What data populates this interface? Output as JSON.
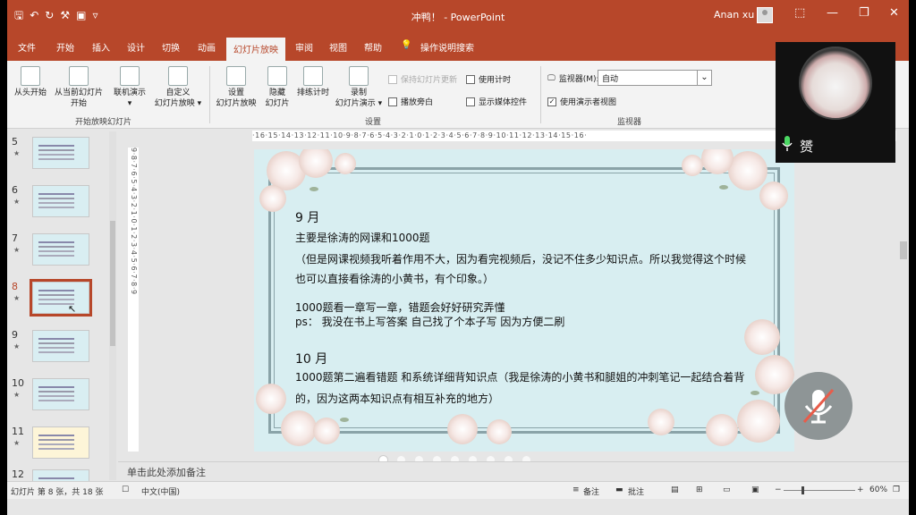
{
  "window": {
    "title": "冲鸭！  -  PowerPoint",
    "user": "Anan xu"
  },
  "tabs": [
    "文件",
    "开始",
    "插入",
    "设计",
    "切换",
    "动画",
    "幻灯片放映",
    "审阅",
    "视图",
    "帮助",
    "操作说明搜索"
  ],
  "active_tab": "幻灯片放映",
  "ribbon": {
    "start_group": {
      "from_beginning": "从头开始",
      "from_current_1": "从当前幻灯片",
      "from_current_2": "开始",
      "online": "联机演示",
      "custom_1": "自定义",
      "custom_2": "幻灯片放映",
      "label": "开始放映幻灯片"
    },
    "setup_group": {
      "setup_1": "设置",
      "setup_2": "幻灯片放映",
      "hide_1": "隐藏",
      "hide_2": "幻灯片",
      "rehearse": "排练计时",
      "record_1": "录制",
      "record_2": "幻灯片演示",
      "keep_updated": "保持幻灯片更新",
      "play_narration": "播放旁白",
      "use_timings": "使用计时",
      "show_controls": "显示媒体控件",
      "label": "设置"
    },
    "monitor_group": {
      "monitor_label": "监视器(M):",
      "monitor_value": "自动",
      "presenter_view": "使用演示者视图",
      "label": "监视器"
    }
  },
  "thumbnails": [
    {
      "num": "5",
      "star": "★"
    },
    {
      "num": "6",
      "star": "★"
    },
    {
      "num": "7",
      "star": "★"
    },
    {
      "num": "8",
      "star": "★",
      "selected": true
    },
    {
      "num": "9",
      "star": "★"
    },
    {
      "num": "10",
      "star": "★"
    },
    {
      "num": "11",
      "star": "★"
    },
    {
      "num": "12",
      "star": "★"
    }
  ],
  "ruler_h": "·16·15·14·13·12·11·10·9·8·7·6·5·4·3·2·1·0·1·2·3·4·5·6·7·8·9·10·11·12·13·14·15·16·",
  "ruler_v": "9·8·7·6·5·4·3·2·1·0·1·2·3·4·5·6·7·8·9",
  "slide": {
    "line1": "9 月",
    "line2": "主要是徐涛的网课和1000题",
    "line3": "（但是网课视频我听着作用不大，因为看完视频后，没记不住多少知识点。所以我觉得这个时候",
    "line4": "也可以直接看徐涛的小黄书，有个印象。）",
    "line5": "1000题看一章写一章，错题会好好研究弄懂",
    "line6": "ps：  我没在书上写答案 自己找了个本子写 因为方便二刷",
    "line7": "10 月",
    "line8": "1000题第二遍看错题 和系统详细背知识点（我是徐涛的小黄书和腿姐的冲刺笔记一起结合着背",
    "line9": "的，因为这两本知识点有相互补充的地方）"
  },
  "notes_placeholder": "单击此处添加备注",
  "status": {
    "slide_info": "幻灯片 第 8 张，共 18 张",
    "language": "中文(中国)",
    "notes": "备注",
    "comments": "批注",
    "zoom": "60%"
  },
  "overlay": {
    "cam_name": "赟"
  }
}
